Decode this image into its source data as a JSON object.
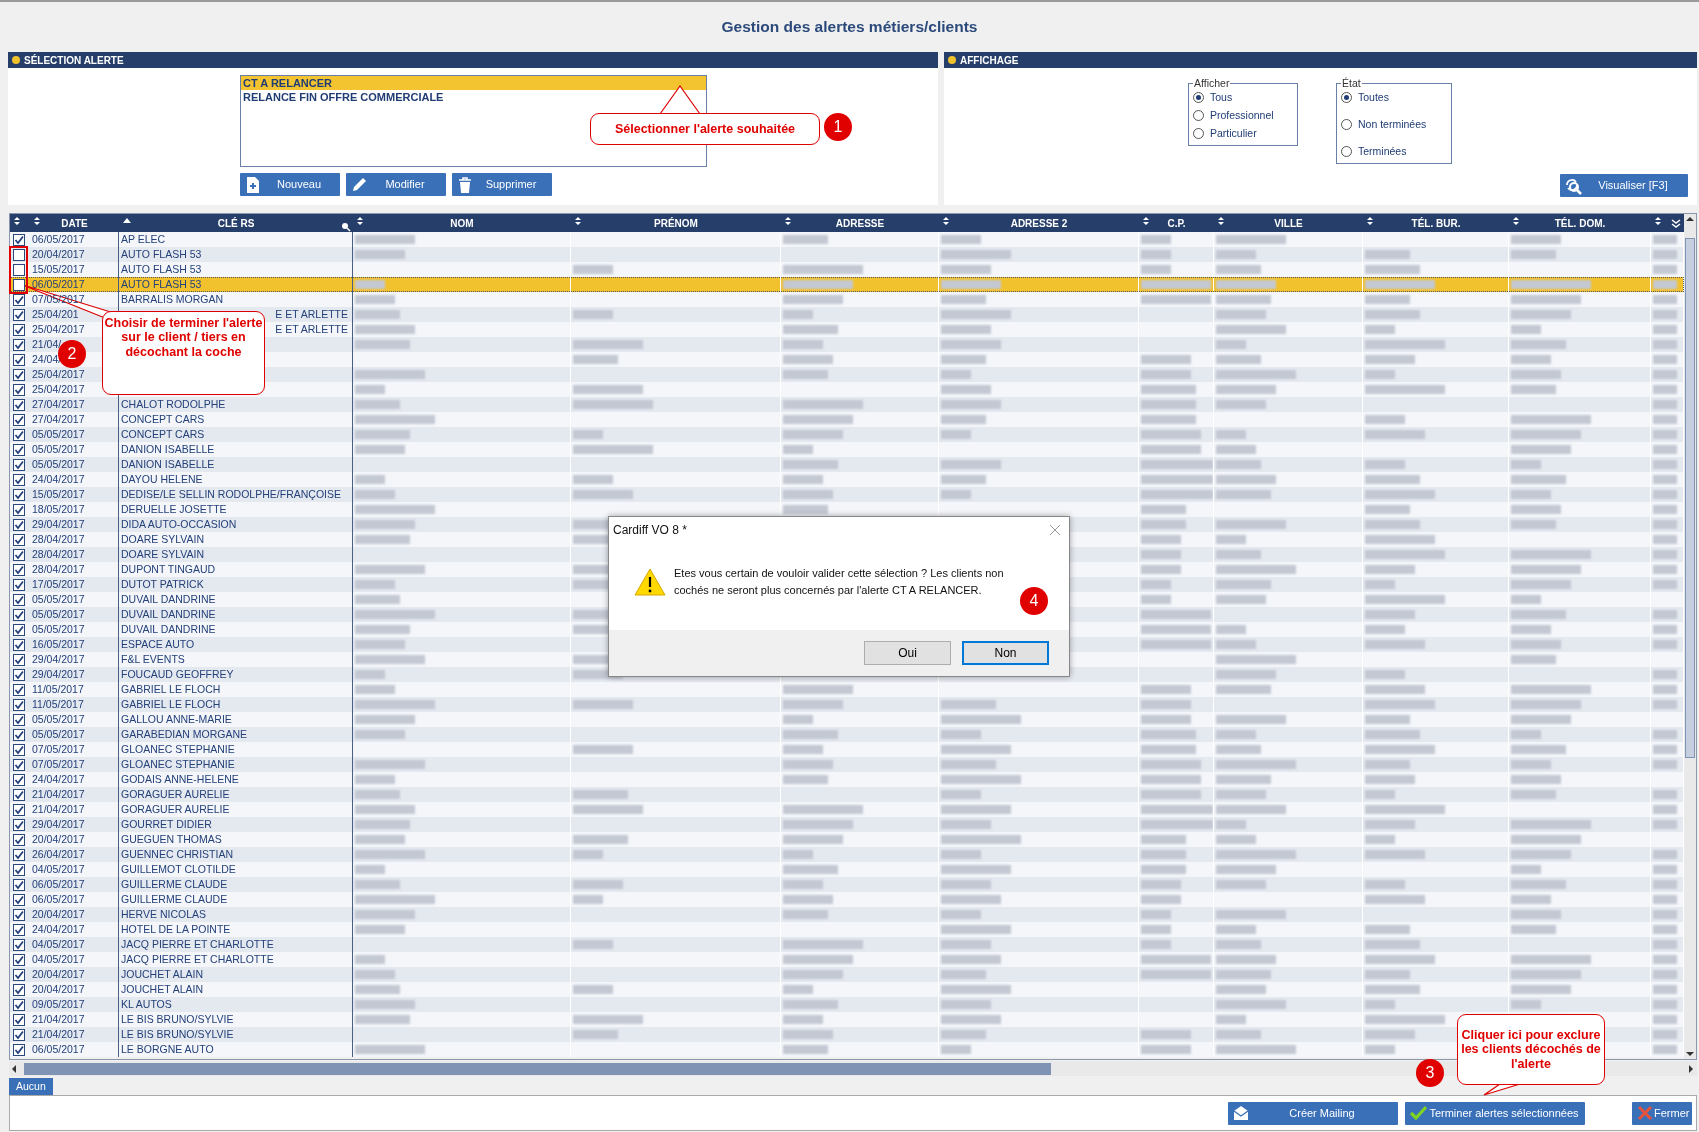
{
  "window": {
    "title": "Gestion des alertes métiers/clients"
  },
  "alert_panel": {
    "title": "SÉLECTION ALERTE",
    "alerts": [
      {
        "label": "CT A RELANCER",
        "selected": true
      },
      {
        "label": "RELANCE FIN OFFRE COMMERCIALE",
        "selected": false
      }
    ],
    "buttons": [
      {
        "label": "Nouveau",
        "kind": "new"
      },
      {
        "label": "Modifier",
        "kind": "edit"
      },
      {
        "label": "Supprimer",
        "kind": "delete"
      }
    ]
  },
  "display_panel": {
    "title": "AFFICHAGE",
    "groups": [
      {
        "legend": "Afficher",
        "options": [
          {
            "label": "Tous",
            "selected": true
          },
          {
            "label": "Professionnel",
            "selected": false
          },
          {
            "label": "Particulier",
            "selected": false
          }
        ]
      },
      {
        "legend": "État",
        "options": [
          {
            "label": "Toutes",
            "selected": true
          },
          {
            "label": "Non terminées",
            "selected": false
          },
          {
            "label": "Terminées",
            "selected": false
          }
        ]
      }
    ],
    "button": "Visualiser [F3]"
  },
  "table": {
    "columns": [
      {
        "sorted": false
      },
      {
        "label": "DATE",
        "sorted": false
      },
      {
        "label": "CLÉ RS",
        "sorted": true
      },
      {
        "label": "NOM",
        "sorted": false
      },
      {
        "label": "PRÉNOM",
        "sorted": false
      },
      {
        "label": "ADRESSE",
        "sorted": false
      },
      {
        "label": "ADRESSE 2",
        "sorted": false
      },
      {
        "label": "C.P.",
        "sorted": false
      },
      {
        "label": "VILLE",
        "sorted": false
      },
      {
        "label": "TÉL. BUR.",
        "sorted": false
      },
      {
        "label": "TÉL. DOM.",
        "sorted": false
      },
      {
        "sorted": false
      }
    ],
    "rows": [
      {
        "checked": true,
        "selected": false,
        "kind": "normal",
        "date": "06/05/2017",
        "cle_rs": "AP ELEC"
      },
      {
        "checked": false,
        "selected": false,
        "kind": "normal",
        "date": "20/04/2017",
        "cle_rs": "AUTO FLASH 53"
      },
      {
        "checked": false,
        "selected": false,
        "kind": "normal",
        "date": "15/05/2017",
        "cle_rs": "AUTO FLASH 53"
      },
      {
        "checked": false,
        "selected": true,
        "kind": "normal",
        "date": "06/05/2017",
        "cle_rs": "AUTO FLASH 53"
      },
      {
        "checked": true,
        "selected": false,
        "kind": "normal",
        "date": "07/05/2017",
        "cle_rs": "BARRALIS MORGAN"
      },
      {
        "checked": true,
        "selected": false,
        "kind": "covered",
        "date": "25/04/201",
        "cle_rs": "E ET ARLETTE"
      },
      {
        "checked": true,
        "selected": false,
        "kind": "covered",
        "date": "25/04/2017",
        "cle_rs": "E ET ARLETTE"
      },
      {
        "checked": true,
        "selected": false,
        "kind": "covered",
        "date": "21/04/"
      },
      {
        "checked": true,
        "selected": false,
        "kind": "covered",
        "date": "24/04/"
      },
      {
        "checked": true,
        "selected": false,
        "kind": "covered",
        "date": "25/04/2017"
      },
      {
        "checked": true,
        "selected": false,
        "kind": "covered",
        "date": "25/04/2017"
      },
      {
        "checked": true,
        "selected": false,
        "kind": "normal",
        "date": "27/04/2017",
        "cle_rs": "CHALOT RODOLPHE"
      },
      {
        "checked": true,
        "selected": false,
        "kind": "normal",
        "date": "27/04/2017",
        "cle_rs": "CONCEPT CARS"
      },
      {
        "checked": true,
        "selected": false,
        "kind": "normal",
        "date": "05/05/2017",
        "cle_rs": "CONCEPT CARS"
      },
      {
        "checked": true,
        "selected": false,
        "kind": "normal",
        "date": "05/05/2017",
        "cle_rs": "DANION ISABELLE"
      },
      {
        "checked": true,
        "selected": false,
        "kind": "normal",
        "date": "05/05/2017",
        "cle_rs": "DANION ISABELLE"
      },
      {
        "checked": true,
        "selected": false,
        "kind": "normal",
        "date": "24/04/2017",
        "cle_rs": "DAYOU HELENE"
      },
      {
        "checked": true,
        "selected": false,
        "kind": "normal",
        "date": "15/05/2017",
        "cle_rs": "DEDISE/LE SELLIN RODOLPHE/FRANÇOISE"
      },
      {
        "checked": true,
        "selected": false,
        "kind": "normal",
        "date": "18/05/2017",
        "cle_rs": "DERUELLE JOSETTE"
      },
      {
        "checked": true,
        "selected": false,
        "kind": "normal",
        "date": "29/04/2017",
        "cle_rs": "DIDA AUTO-OCCASION"
      },
      {
        "checked": true,
        "selected": false,
        "kind": "normal",
        "date": "28/04/2017",
        "cle_rs": "DOARE SYLVAIN"
      },
      {
        "checked": true,
        "selected": false,
        "kind": "normal",
        "date": "28/04/2017",
        "cle_rs": "DOARE SYLVAIN"
      },
      {
        "checked": true,
        "selected": false,
        "kind": "normal",
        "date": "28/04/2017",
        "cle_rs": "DUPONT TINGAUD"
      },
      {
        "checked": true,
        "selected": false,
        "kind": "normal",
        "date": "17/05/2017",
        "cle_rs": "DUTOT PATRICK"
      },
      {
        "checked": true,
        "selected": false,
        "kind": "normal",
        "date": "05/05/2017",
        "cle_rs": "DUVAIL DANDRINE"
      },
      {
        "checked": true,
        "selected": false,
        "kind": "normal",
        "date": "05/05/2017",
        "cle_rs": "DUVAIL DANDRINE"
      },
      {
        "checked": true,
        "selected": false,
        "kind": "normal",
        "date": "05/05/2017",
        "cle_rs": "DUVAIL DANDRINE"
      },
      {
        "checked": true,
        "selected": false,
        "kind": "normal",
        "date": "16/05/2017",
        "cle_rs": "ESPACE AUTO"
      },
      {
        "checked": true,
        "selected": false,
        "kind": "normal",
        "date": "29/04/2017",
        "cle_rs": "F&L EVENTS"
      },
      {
        "checked": true,
        "selected": false,
        "kind": "normal",
        "date": "29/04/2017",
        "cle_rs": "FOUCAUD GEOFFREY"
      },
      {
        "checked": true,
        "selected": false,
        "kind": "normal",
        "date": "11/05/2017",
        "cle_rs": "GABRIEL LE FLOCH"
      },
      {
        "checked": true,
        "selected": false,
        "kind": "normal",
        "date": "11/05/2017",
        "cle_rs": "GABRIEL LE FLOCH"
      },
      {
        "checked": true,
        "selected": false,
        "kind": "normal",
        "date": "05/05/2017",
        "cle_rs": "GALLOU ANNE-MARIE"
      },
      {
        "checked": true,
        "selected": false,
        "kind": "normal",
        "date": "05/05/2017",
        "cle_rs": "GARABEDIAN MORGANE"
      },
      {
        "checked": true,
        "selected": false,
        "kind": "normal",
        "date": "07/05/2017",
        "cle_rs": "GLOANEC STEPHANIE"
      },
      {
        "checked": true,
        "selected": false,
        "kind": "normal",
        "date": "07/05/2017",
        "cle_rs": "GLOANEC STEPHANIE"
      },
      {
        "checked": true,
        "selected": false,
        "kind": "normal",
        "date": "24/04/2017",
        "cle_rs": "GODAIS ANNE-HELENE"
      },
      {
        "checked": true,
        "selected": false,
        "kind": "normal",
        "date": "21/04/2017",
        "cle_rs": "GORAGUER AURELIE"
      },
      {
        "checked": true,
        "selected": false,
        "kind": "normal",
        "date": "21/04/2017",
        "cle_rs": "GORAGUER AURELIE"
      },
      {
        "checked": true,
        "selected": false,
        "kind": "normal",
        "date": "29/04/2017",
        "cle_rs": "GOURRET DIDIER"
      },
      {
        "checked": true,
        "selected": false,
        "kind": "normal",
        "date": "20/04/2017",
        "cle_rs": "GUEGUEN THOMAS"
      },
      {
        "checked": true,
        "selected": false,
        "kind": "normal",
        "date": "26/04/2017",
        "cle_rs": "GUENNEC CHRISTIAN"
      },
      {
        "checked": true,
        "selected": false,
        "kind": "normal",
        "date": "04/05/2017",
        "cle_rs": "GUILLEMOT CLOTILDE"
      },
      {
        "checked": true,
        "selected": false,
        "kind": "normal",
        "date": "06/05/2017",
        "cle_rs": "GUILLERME  CLAUDE"
      },
      {
        "checked": true,
        "selected": false,
        "kind": "normal",
        "date": "06/05/2017",
        "cle_rs": "GUILLERME  CLAUDE"
      },
      {
        "checked": true,
        "selected": false,
        "kind": "normal",
        "date": "20/04/2017",
        "cle_rs": "HERVE NICOLAS"
      },
      {
        "checked": true,
        "selected": false,
        "kind": "normal",
        "date": "24/04/2017",
        "cle_rs": "HOTEL DE LA POINTE"
      },
      {
        "checked": true,
        "selected": false,
        "kind": "normal",
        "date": "04/05/2017",
        "cle_rs": "JACQ PIERRE ET CHARLOTTE"
      },
      {
        "checked": true,
        "selected": false,
        "kind": "normal",
        "date": "04/05/2017",
        "cle_rs": "JACQ PIERRE ET CHARLOTTE"
      },
      {
        "checked": true,
        "selected": false,
        "kind": "normal",
        "date": "20/04/2017",
        "cle_rs": "JOUCHET ALAIN"
      },
      {
        "checked": true,
        "selected": false,
        "kind": "normal",
        "date": "20/04/2017",
        "cle_rs": "JOUCHET ALAIN"
      },
      {
        "checked": true,
        "selected": false,
        "kind": "normal",
        "date": "09/05/2017",
        "cle_rs": "KL AUTOS"
      },
      {
        "checked": true,
        "selected": false,
        "kind": "normal",
        "date": "21/04/2017",
        "cle_rs": "LE BIS BRUNO/SYLVIE"
      },
      {
        "checked": true,
        "selected": false,
        "kind": "normal",
        "date": "21/04/2017",
        "cle_rs": "LE BIS BRUNO/SYLVIE"
      },
      {
        "checked": true,
        "selected": false,
        "kind": "normal",
        "date": "06/05/2017",
        "cle_rs": "LE BORGNE  AUTO"
      }
    ]
  },
  "status_tabs": [
    {
      "label": "Aucun",
      "selected": true
    }
  ],
  "footer_buttons": [
    {
      "label": "Créer Mailing",
      "kind": "mail"
    },
    {
      "label": "Terminer alertes sélectionnées",
      "kind": "check"
    },
    {
      "label": "Fermer",
      "kind": "close"
    }
  ],
  "dialog": {
    "title": "Cardiff VO 8 *",
    "message": "Etes vous certain de vouloir valider cette sélection ?  Les clients non cochés ne seront plus concernés par l'alerte CT A RELANCER.",
    "buttons": [
      {
        "label": "Oui",
        "focused": false
      },
      {
        "label": "Non",
        "focused": true
      }
    ]
  },
  "annotations": [
    {
      "number": "1",
      "text": "Sélectionner l'alerte souhaitée"
    },
    {
      "number": "2",
      "text": "Choisir de terminer l'alerte sur le client / tiers en décochant la coche"
    },
    {
      "number": "3",
      "text": "Cliquer ici pour exclure les clients décochés de l'alerte"
    },
    {
      "number": "4"
    }
  ]
}
